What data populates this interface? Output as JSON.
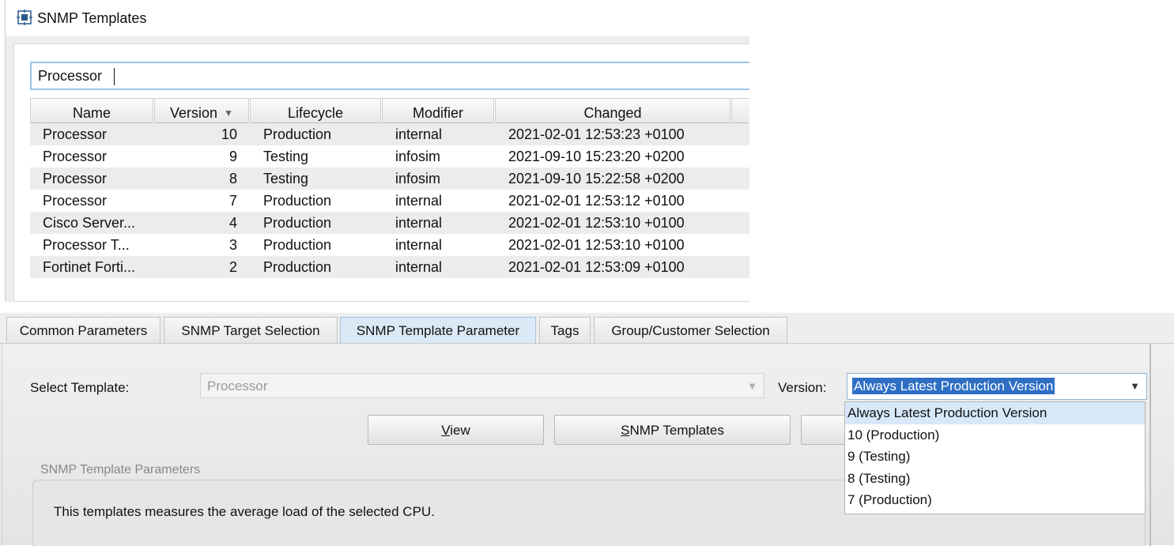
{
  "template_window": {
    "title": "SNMP Templates",
    "search_value": "Processor",
    "columns": [
      "Name",
      "Version",
      "Lifecycle",
      "Modifier",
      "Changed"
    ],
    "sort_column": "Version",
    "rows": [
      {
        "name": "Processor",
        "version": "10",
        "lifecycle": "Production",
        "modifier": "internal",
        "changed": "2021-02-01 12:53:23 +0100"
      },
      {
        "name": "Processor",
        "version": "9",
        "lifecycle": "Testing",
        "modifier": "infosim",
        "changed": "2021-09-10 15:23:20 +0200"
      },
      {
        "name": "Processor",
        "version": "8",
        "lifecycle": "Testing",
        "modifier": "infosim",
        "changed": "2021-09-10 15:22:58 +0200"
      },
      {
        "name": "Processor",
        "version": "7",
        "lifecycle": "Production",
        "modifier": "internal",
        "changed": "2021-02-01 12:53:12 +0100"
      },
      {
        "name": "Cisco Server...",
        "version": "4",
        "lifecycle": "Production",
        "modifier": "internal",
        "changed": "2021-02-01 12:53:10 +0100"
      },
      {
        "name": "Processor T...",
        "version": "3",
        "lifecycle": "Production",
        "modifier": "internal",
        "changed": "2021-02-01 12:53:10 +0100"
      },
      {
        "name": "Fortinet Forti...",
        "version": "2",
        "lifecycle": "Production",
        "modifier": "internal",
        "changed": "2021-02-01 12:53:09 +0100"
      }
    ]
  },
  "tabs": [
    {
      "label": "Common Parameters",
      "active": false
    },
    {
      "label": "SNMP Target Selection",
      "active": false
    },
    {
      "label": "SNMP Template Parameter",
      "active": true
    },
    {
      "label": "Tags",
      "active": false
    },
    {
      "label": "Group/Customer Selection",
      "active": false
    }
  ],
  "form": {
    "select_template_label": "Select Template:",
    "select_template_value": "Processor",
    "version_label": "Version:",
    "version_value": "Always Latest Production Version",
    "buttons": {
      "view": {
        "mnemonic": "V",
        "rest": "iew"
      },
      "snmp_templates": {
        "mnemonic": "S",
        "rest": "NMP Templates"
      }
    },
    "parameters_group_title": "SNMP Template Parameters",
    "parameters_description": "This templates measures the average load of the selected CPU."
  },
  "version_dropdown": {
    "options": [
      "Always Latest Production Version",
      "10 (Production)",
      "9 (Testing)",
      "8 (Testing)",
      "7 (Production)"
    ],
    "highlighted_index": 0
  },
  "colors": {
    "accent_blue": "#2e6fc4",
    "highlight": "#d7e8f8",
    "active_tab": "#dbe9f6"
  },
  "icons": {
    "app": "snmp-templates-icon",
    "sort": "sort-descending-icon",
    "dropdown": "chevron-down-icon"
  }
}
